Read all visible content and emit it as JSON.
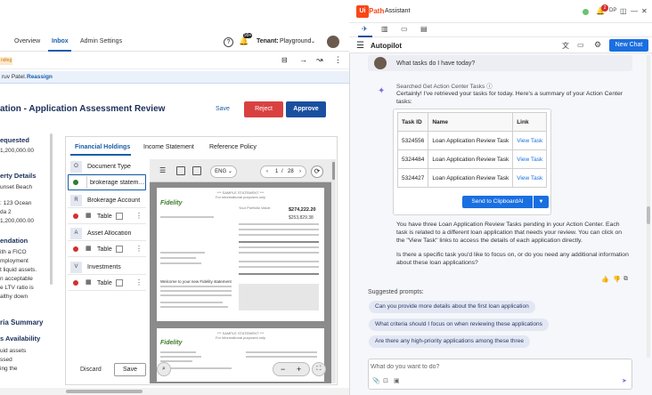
{
  "left": {
    "nav": {
      "overview": "Overview",
      "inbox": "Inbox",
      "admin": "Admin Settings",
      "help": "?",
      "tenant_label": "Tenant:",
      "tenant_value": "Playground"
    },
    "bell_badge": "99+",
    "pending": "nding",
    "banner": {
      "prefix": "ruv Patel.",
      "action": "Reassign"
    },
    "title": "ation - Application Assessment Review",
    "buttons": {
      "save": "Save",
      "reject": "Reject",
      "approve": "Approve",
      "discard": "Discard",
      "save_bottom": "Save"
    },
    "summary": {
      "requested_head": "equested",
      "requested_value": "1,200,000.00",
      "property_head": "erty Details",
      "property_lines": [
        "unset Beach",
        "",
        ": 123 Ocean",
        "da 2",
        "1,200,000.00"
      ],
      "recommendation_head": "endation",
      "recommendation_lines": [
        "ith a FICO",
        "mployment",
        "t liquid assets.",
        "n acceptable",
        "e LTV ratio is",
        "althy down"
      ],
      "area_head": "ria Summary",
      "avail_head": "s Availability",
      "avail_lines": [
        "uid assets",
        "ssed",
        "ing the"
      ]
    },
    "doc_tabs": [
      "Financial Holdings",
      "Income Statement",
      "Reference Policy"
    ],
    "fields": [
      {
        "letter": "O",
        "label": "Document Type",
        "color": ""
      },
      {
        "letter": "",
        "label": "brokerage statement",
        "color": "#2e7d32"
      },
      {
        "letter": "R",
        "label": "Brokerage Account",
        "color": ""
      },
      {
        "letter": "",
        "label": "Table",
        "color": "#d32f2f"
      },
      {
        "letter": "A",
        "label": "Asset Allocation",
        "color": ""
      },
      {
        "letter": "",
        "label": "Table",
        "color": "#d32f2f"
      },
      {
        "letter": "V",
        "label": "Investments",
        "color": ""
      },
      {
        "letter": "",
        "label": "Table",
        "color": "#d32f2f"
      }
    ],
    "pdf": {
      "lang": "ENG",
      "page_current": "1",
      "page_sep": "/",
      "page_total": "28",
      "sample_line": "*** SAMPLE STATEMENT ***",
      "sample_sub": "For informational purposes only",
      "logo": "Fidelity",
      "value_label": "Your Portfolio Value:",
      "value": "$274,222.20",
      "value_2": "$253,829.38",
      "welcome": "Welcome to your new Fidelity statement"
    }
  },
  "right": {
    "brand": "Path",
    "brand_u": "Ui",
    "app": "Assistant",
    "badge": "2",
    "user_initials": "DP",
    "autopilot": "Autopilot",
    "new_chat": "New Chat",
    "user_message": "What tasks do I have today?",
    "searched": "Searched Get Action Center Tasks",
    "intro": "Certainly! I've retrieved your tasks for today. Here's a summary of your Action Center tasks:",
    "table": {
      "headers": [
        "Task ID",
        "Name",
        "Link"
      ],
      "rows": [
        [
          "5324556",
          "Loan Application Review Task",
          "View Task"
        ],
        [
          "5324484",
          "Loan Application Review Task",
          "View Task"
        ],
        [
          "5324427",
          "Loan Application Review Task",
          "View Task"
        ]
      ]
    },
    "send_button": "Send to ClipboardAI",
    "para1": "You have three Loan Application Review Tasks pending in your Action Center. Each task is related to a different loan application that needs your review. You can click on the \"View Task\" links to access the details of each application directly.",
    "para2": "Is there a specific task you'd like to focus on, or do you need any additional information about these loan applications?",
    "suggested_label": "Suggested prompts:",
    "prompts": [
      "Can you provide more details about the first loan application",
      "What criteria should I focus on when reviewing these applications",
      "Are there any high-priority applications among these three"
    ],
    "input_placeholder": "What do you want to do?"
  }
}
